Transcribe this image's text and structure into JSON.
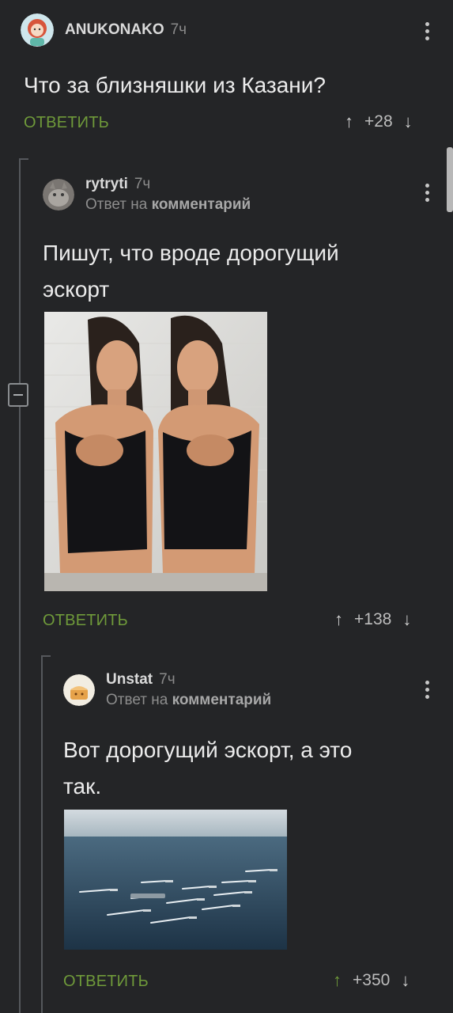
{
  "comments": [
    {
      "username": "ANUKONAKO",
      "time": "7ч",
      "text": "Что за близняшки из Казани?",
      "reply_label": "ОТВЕТИТЬ",
      "score": "+28"
    },
    {
      "username": "rytryti",
      "time": "7ч",
      "reply_prefix": "Ответ на",
      "reply_target": "комментарий",
      "text_line1": "Пишут, что вроде дорогущий",
      "text_line2": "эскорт",
      "reply_label": "ОТВЕТИТЬ",
      "score": "+138"
    },
    {
      "username": "Unstat",
      "time": "7ч",
      "reply_prefix": "Ответ на",
      "reply_target": "комментарий",
      "text_line1": "Вот дорогущий эскорт, а это",
      "text_line2": "так.",
      "reply_label": "ОТВЕТИТЬ",
      "score": "+350"
    }
  ],
  "colors": {
    "background": "#242527",
    "accent_green": "#6f9a3a",
    "thread_line": "#55585c"
  },
  "icons": {
    "upvote": "arrow-up-icon",
    "downvote": "arrow-down-icon",
    "menu": "kebab-menu-icon",
    "collapse": "minus-box-icon"
  }
}
